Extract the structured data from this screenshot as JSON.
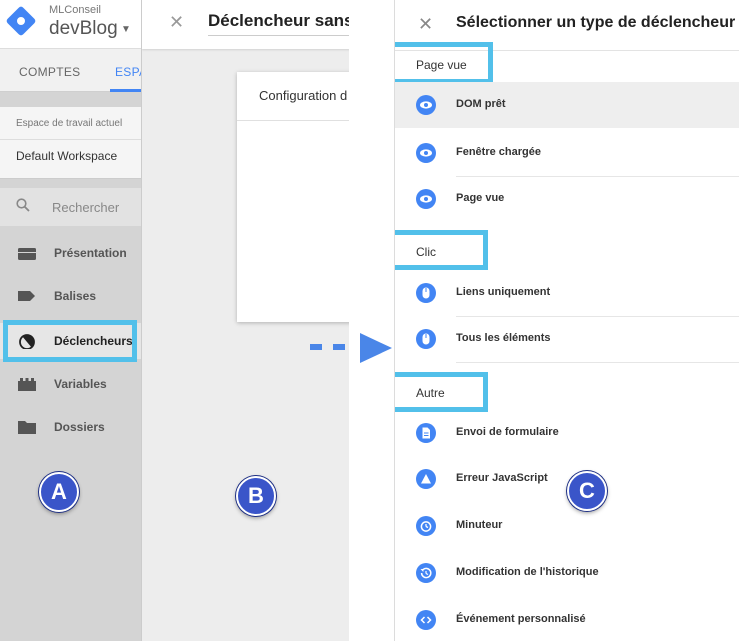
{
  "pane_a": {
    "account_name": "MLConseil",
    "container_name": "devBlog",
    "tabs": [
      {
        "label": "COMPTES"
      },
      {
        "label": "ESPA"
      }
    ],
    "workspace_label": "Espace de travail actuel",
    "workspace_name": "Default Workspace",
    "search_placeholder": "Rechercher",
    "nav": [
      {
        "label": "Présentation",
        "icon": "briefcase-icon"
      },
      {
        "label": "Balises",
        "icon": "tag-icon"
      },
      {
        "label": "Déclencheurs",
        "icon": "trigger-icon",
        "active": true
      },
      {
        "label": "Variables",
        "icon": "variables-icon"
      },
      {
        "label": "Dossiers",
        "icon": "folder-icon"
      }
    ],
    "badge": "A"
  },
  "pane_b": {
    "title": "Déclencheur sans",
    "card_title": "Configuration d",
    "badge": "B"
  },
  "pane_c": {
    "title": "Sélectionner un type de déclencheur",
    "sections": [
      {
        "label": "Page vue",
        "items": [
          "DOM prêt",
          "Fenêtre chargée",
          "Page vue"
        ]
      },
      {
        "label": "Clic",
        "items": [
          "Liens uniquement",
          "Tous les éléments"
        ]
      },
      {
        "label": "Autre",
        "items": [
          "Envoi de formulaire",
          "Erreur JavaScript",
          "Minuteur",
          "Modification de l'historique",
          "Événement personnalisé"
        ]
      }
    ],
    "badge": "C"
  },
  "colors": {
    "accent_blue": "#4285f4",
    "highlight_cyan": "#52c0ea",
    "badge_blue": "#3a55c9",
    "arrow_blue": "#4a86e8"
  }
}
